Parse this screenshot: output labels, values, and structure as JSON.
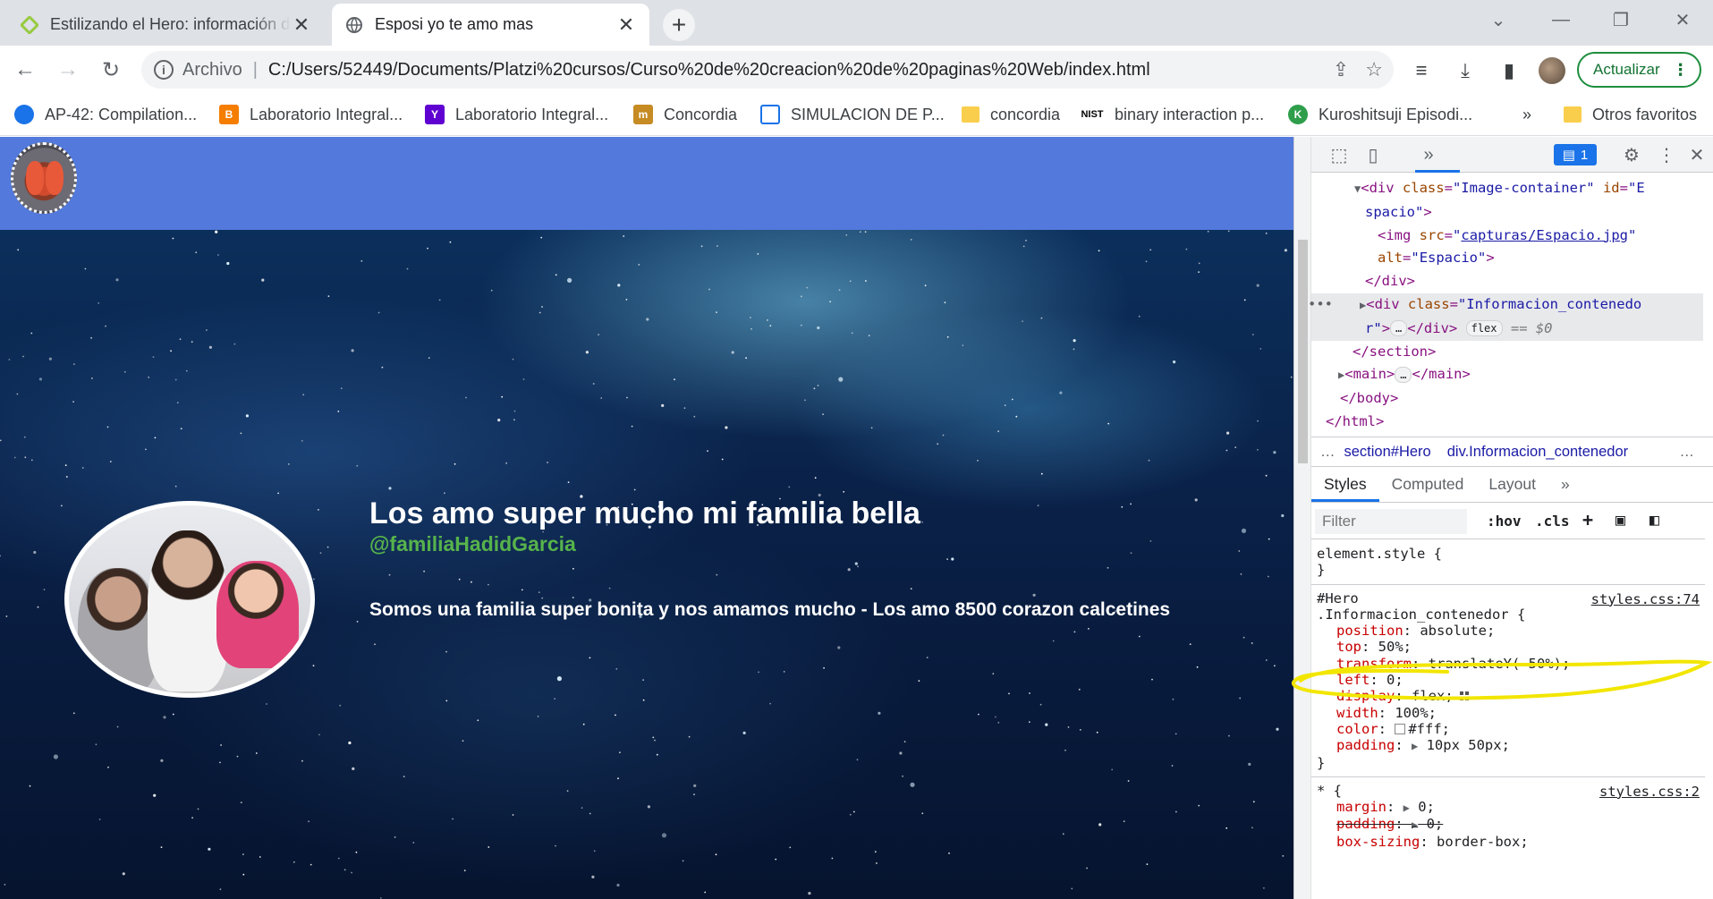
{
  "tabs": [
    {
      "title": "Estilizando el Hero: información d",
      "favicon": "platzi-icon"
    },
    {
      "title": "Esposi yo te amo mas",
      "favicon": "globe-icon"
    }
  ],
  "address": {
    "scheme": "Archivo",
    "url": "C:/Users/52449/Documents/Platzi%20cursos/Curso%20de%20creacion%20de%20paginas%20Web/index.html"
  },
  "update_label": "Actualizar",
  "bookmarks": [
    {
      "label": "AP-42: Compilation...",
      "icon": "ap42-icon",
      "color": "#1a73e8"
    },
    {
      "label": "Laboratorio Integral...",
      "icon": "blogger-icon",
      "color": "#f57d00"
    },
    {
      "label": "Laboratorio Integral...",
      "icon": "yahoo-icon",
      "color": "#5f01d1"
    },
    {
      "label": "Concordia",
      "icon": "concordia-icon",
      "color": "#c68b22"
    },
    {
      "label": "SIMULACION DE P...",
      "icon": "sim-icon",
      "color": "#1a73e8"
    },
    {
      "label": "concordia",
      "icon": "folder-icon",
      "color": "#f9ce4c"
    },
    {
      "label": "binary interaction p...",
      "icon": "nist-icon",
      "color": "#000000"
    },
    {
      "label": "Kuroshitsuji Episodi...",
      "icon": "kuro-icon",
      "color": "#2e9e4a"
    }
  ],
  "bookmarks_more": "»",
  "other_bookmarks": "Otros favoritos",
  "page": {
    "header_color": "#5279db",
    "hero_title": "Los amo super mucho mi familia bella",
    "hero_handle": "@familiaHadidGarcia",
    "hero_description": "Somos una familia super bonita y nos amamos mucho - Los amo 8500 corazon calcetines",
    "handle_color": "#57b34b"
  },
  "devtools": {
    "issues_count": "1",
    "dom": {
      "l1_tag": "div",
      "l1_class": "Image-container",
      "l1_id_a": "E",
      "l1_id_b": "spacio",
      "l2_src": "capturas/Espacio.jpg",
      "l2_alt": "Espacio",
      "l3_close": "</div>",
      "l4_class_a": "Informacion_contenedo",
      "l4_class_b": "r",
      "l4_pill": "flex",
      "l4_eq": "== $0",
      "l5": "</section>",
      "l6_tag": "main",
      "l7": "</body>",
      "l8": "</html>"
    },
    "breadcrumbs": [
      "section#Hero",
      "div.Informacion_contenedor"
    ],
    "style_tabs": [
      "Styles",
      "Computed",
      "Layout",
      "»"
    ],
    "filter_placeholder": "Filter",
    "filter_buttons": [
      ":hov",
      ".cls",
      "+"
    ],
    "rules": {
      "element_style": "element.style {",
      "hero_selector_1": "#Hero",
      "hero_selector_2": ".Informacion_contenedor {",
      "hero_source": "styles.css:74",
      "props": [
        {
          "name": "position",
          "value": "absolute;"
        },
        {
          "name": "top",
          "value": "50%;"
        },
        {
          "name": "transform",
          "value": "translateY(-50%);"
        },
        {
          "name": "left",
          "value": "0;"
        },
        {
          "name": "display",
          "value": "flex;"
        },
        {
          "name": "width",
          "value": "100%;"
        },
        {
          "name": "color",
          "value": "#fff;"
        },
        {
          "name": "padding",
          "value": "10px 50px;"
        }
      ],
      "universal_selector": "* {",
      "universal_source": "styles.css:2",
      "universal_props": [
        {
          "name": "margin",
          "value": "0;"
        },
        {
          "name": "padding",
          "value": "0;"
        },
        {
          "name": "box-sizing",
          "value": "border-box;"
        }
      ]
    },
    "highlight_color": "#f2e600"
  }
}
